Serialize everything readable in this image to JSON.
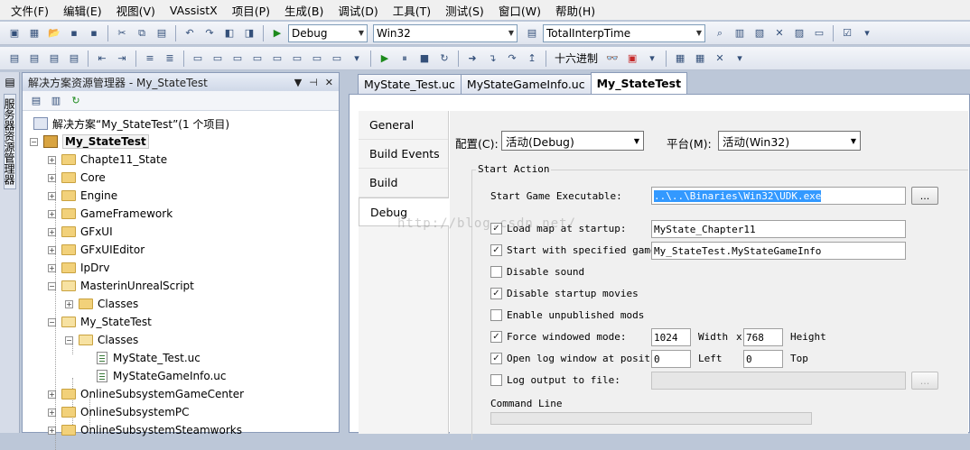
{
  "menu": [
    "文件(F)",
    "编辑(E)",
    "视图(V)",
    "VAssistX",
    "项目(P)",
    "生成(B)",
    "调试(D)",
    "工具(T)",
    "测试(S)",
    "窗口(W)",
    "帮助(H)"
  ],
  "toolbar": {
    "config_value": "Debug",
    "platform_value": "Win32",
    "find_value": "TotalInterpTime",
    "hex_label": "十六进制"
  },
  "sidebar": {
    "vertical_tab": "服务器资源管理器"
  },
  "explorer": {
    "title": "解决方案资源管理器 - My_StateTest",
    "solution_label": "解决方案“My_StateTest”(1 个项目)",
    "project_label": "My_StateTest",
    "folders": [
      "Chapte11_State",
      "Core",
      "Engine",
      "GameFramework",
      "GFxUI",
      "GFxUIEditor",
      "IpDrv",
      "MasterinUnrealScript"
    ],
    "masterin_child": "Classes",
    "mystatetest_folder": "My_StateTest",
    "classes_folder": "Classes",
    "files": [
      "MyState_Test.uc",
      "MyStateGameInfo.uc"
    ],
    "folders_after": [
      "OnlineSubsystemGameCenter",
      "OnlineSubsystemPC",
      "OnlineSubsystemSteamworks"
    ]
  },
  "tabs": [
    "MyState_Test.uc",
    "MyStateGameInfo.uc",
    "My_StateTest"
  ],
  "props": {
    "nav": [
      "General",
      "Build Events",
      "Build",
      "Debug"
    ],
    "config_label": "配置(C):",
    "config_value": "活动(Debug)",
    "platform_label": "平台(M):",
    "platform_value": "活动(Win32)",
    "start_action_title": "Start Action",
    "start_exe_label": "Start Game Executable:",
    "start_exe_value": "..\\..\\Binaries\\Win32\\UDK.exe",
    "browse": "...",
    "load_map_label": "Load map at startup:",
    "load_map_value": "MyState_Chapter11",
    "game_label": "Start with specified game t",
    "game_value": "My_StateTest.MyStateGameInfo",
    "disable_sound": "Disable sound",
    "disable_movies": "Disable startup movies",
    "enable_unpublished": "Enable unpublished mods",
    "force_windowed": "Force windowed mode:",
    "width_value": "1024",
    "width_label": "Width",
    "x_label": "x",
    "height_value": "768",
    "height_label": "Height",
    "open_log": "Open log window at position:",
    "left_value": "0",
    "left_label": "Left",
    "top_value": "0",
    "top_label": "Top",
    "log_output": "Log output to file:",
    "command_line": "Command Line"
  },
  "watermark": "http://blog.csdn.net/"
}
